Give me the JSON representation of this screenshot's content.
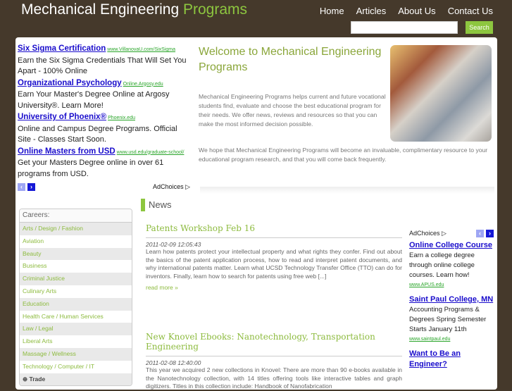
{
  "header": {
    "title_main": "Mechanical Engineering",
    "title_accent": "Programs",
    "nav": [
      "Home",
      "Articles",
      "About Us",
      "Contact Us"
    ],
    "search_placeholder": "",
    "search_button": "Search"
  },
  "left_ads": [
    {
      "title": "Six Sigma Certification",
      "url": "www.VillanovaU.com/SixSigma",
      "text": "Earn the Six Sigma Credentials That Will Set You Apart - 100% Online"
    },
    {
      "title": "Organizational Psychology",
      "url": "Online.Argosy.edu",
      "text": "Earn Your Master's Degree Online at Argosy University®. Learn More!"
    },
    {
      "title": "University of Phoenix®",
      "url": "Phoenix.edu",
      "text": "Online and Campus Degree Programs. Official Site - Classes Start Soon."
    },
    {
      "title": "Online Masters from USD",
      "url": "www.usd.edu/graduate-school/",
      "text": "Get your Masters Degree online in over 61 programs from USD."
    }
  ],
  "adchoices": "AdChoices",
  "welcome": {
    "title": "Welcome to Mechanical Engineering Programs",
    "p1": "Mechanical Engineering Programs helps current and future vocational students find, evaluate and choose the best educational program for their needs. We offer news, reviews and resources so that you can make the most informed decision possible.",
    "p2": "We hope that Mechanical Engineering Programs will become an invaluable, complimentary resource to your educational program research, and that you will come back frequently."
  },
  "careers": {
    "heading": "Careers:",
    "items": [
      "Arts / Design / Fashion",
      "Aviation",
      "Beauty",
      "Business",
      "Criminal Justice",
      "Culinary Arts",
      "Education",
      "Health Care / Human Services",
      "Law / Legal",
      "Liberal Arts",
      "Massage / Wellness",
      "Technology / Computer / IT"
    ],
    "trade": "Trade"
  },
  "news": {
    "heading": "News",
    "posts": [
      {
        "title": "Patents Workshop Feb 16",
        "date": "2011-02-09 12:05:43",
        "body": "Learn how patents protect your intellectual property and what rights they confer. Find out about the basics of the patent application process, how to read and interpret patent documents, and why international patents matter. Learn what UCSD Technology Transfer Office (TTO) can do for inventors. Finally, learn how to search for patents using free web [...]",
        "more": "read more »"
      },
      {
        "title": "New Knovel Ebooks: Nanotechnology, Transportation Engineering",
        "date": "2011-02-08 12:40:00",
        "body": "This year we acquired 2 new collections in Knovel: There are more than 90 e-books available in the Nanotechnology collection, with 14 titles offering tools like interactive tables and graph digitizers. Titles in this collection include: Handbook of Nanofabrication"
      }
    ]
  },
  "right_ads": [
    {
      "title": "Online College Course",
      "text": "Earn a college degree through online college courses. Learn how!",
      "url": "www.APUS.edu"
    },
    {
      "title": "Saint Paul College, MN",
      "text": "Accounting Programs & Degrees Spring Semester Starts January 11th",
      "url": "www.saintpaul.edu"
    },
    {
      "title": "Want to Be an Engineer?"
    }
  ]
}
